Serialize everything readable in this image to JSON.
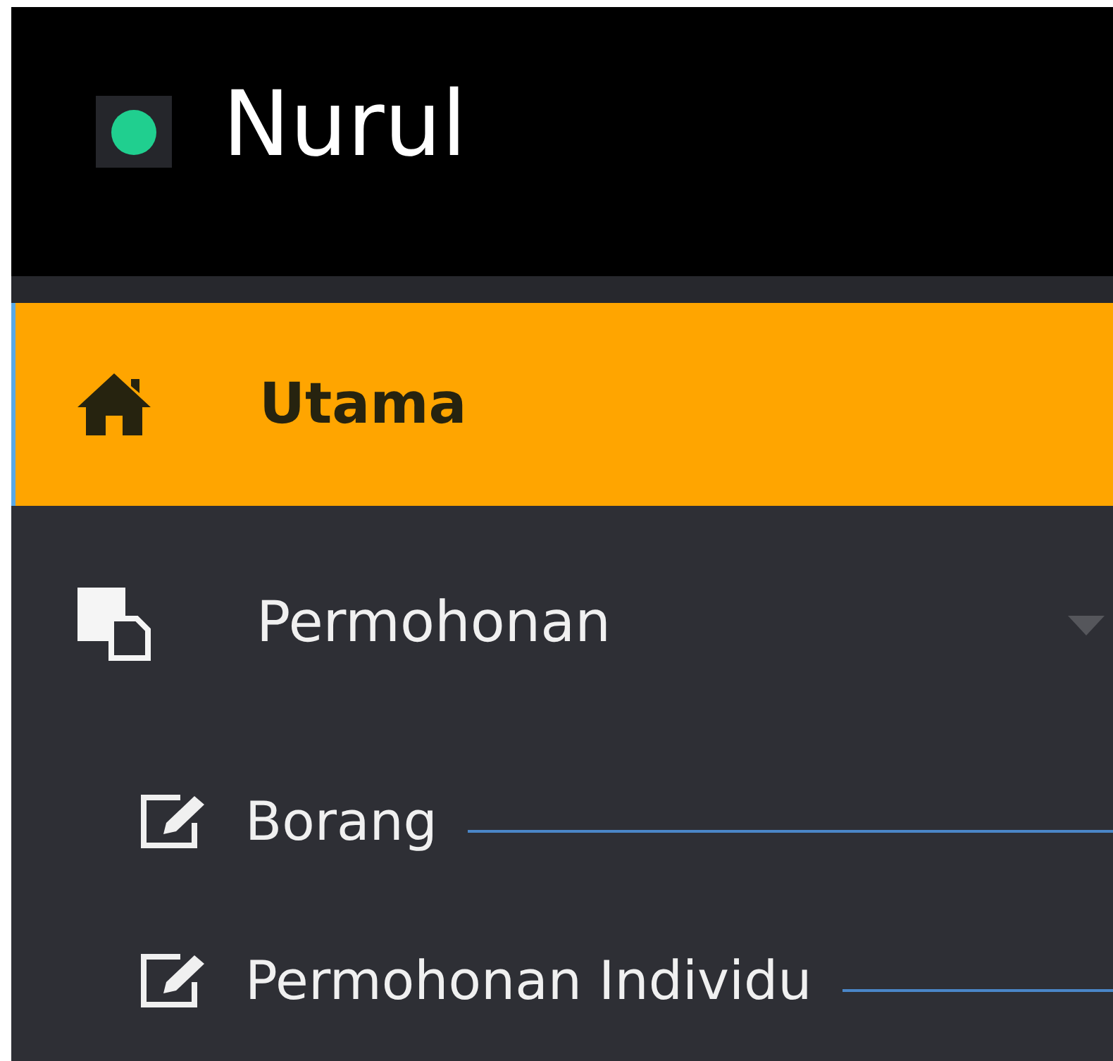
{
  "header": {
    "user_name": "Nurul",
    "online": true
  },
  "menu": [
    {
      "label": "Utama",
      "kind": "home",
      "selected": true
    },
    {
      "label": "Permohonan",
      "kind": "documents",
      "selected": false,
      "expanded": true,
      "children": [
        {
          "label": "Borang",
          "kind": "edit",
          "selected": false
        },
        {
          "label": "Permohonan Individu",
          "kind": "edit",
          "selected": false
        }
      ]
    }
  ]
}
